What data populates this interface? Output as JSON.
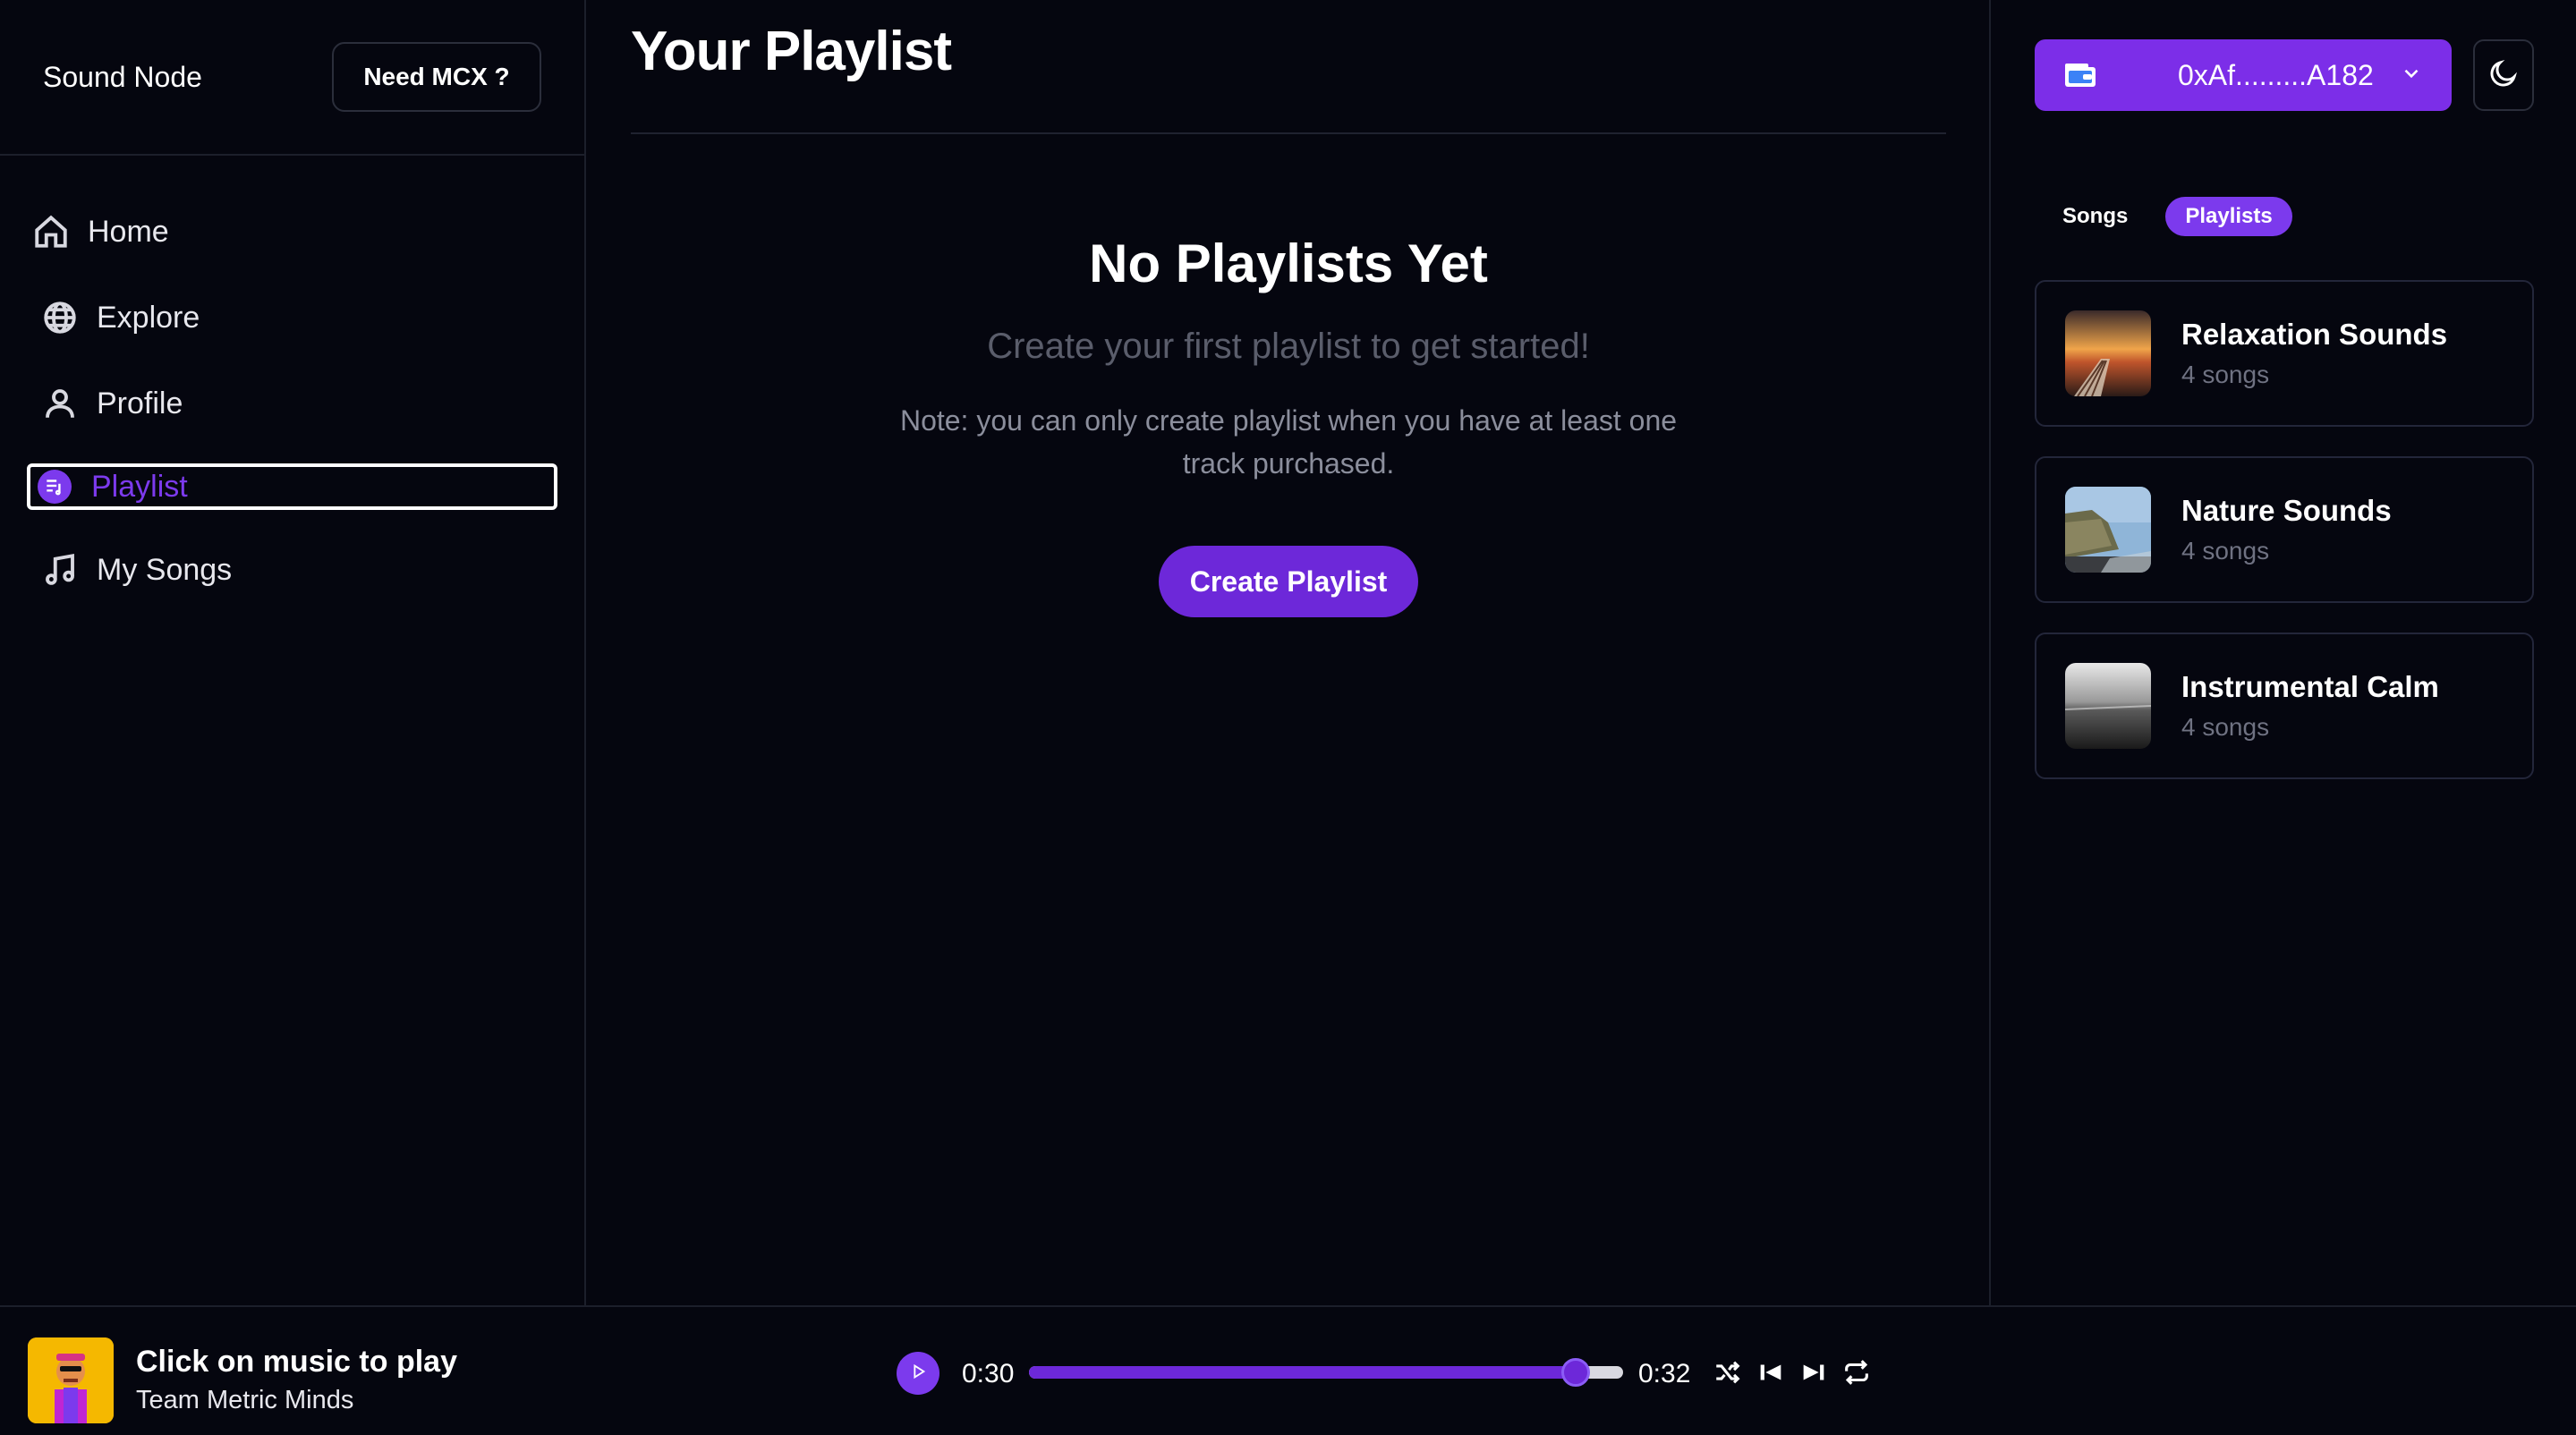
{
  "sidebar": {
    "brand": "Sound Node",
    "need_button": "Need MCX ?",
    "items": [
      {
        "label": "Home",
        "icon": "home-icon"
      },
      {
        "label": "Explore",
        "icon": "globe-icon"
      },
      {
        "label": "Profile",
        "icon": "user-icon"
      },
      {
        "label": "Playlist",
        "icon": "playlist-icon",
        "active": true
      },
      {
        "label": "My Songs",
        "icon": "music-note-icon"
      }
    ]
  },
  "main": {
    "title": "Your Playlist",
    "empty_heading": "No Playlists Yet",
    "empty_sub": "Create your first playlist to get started!",
    "empty_note": "Note: you can only create playlist when you have at least one track purchased.",
    "create_button": "Create Playlist"
  },
  "right": {
    "wallet_address": "0xAf.........A182",
    "tabs": [
      {
        "label": "Songs",
        "selected": false
      },
      {
        "label": "Playlists",
        "selected": true
      }
    ],
    "playlists": [
      {
        "title": "Relaxation Sounds",
        "count": "4 songs"
      },
      {
        "title": "Nature Sounds",
        "count": "4 songs"
      },
      {
        "title": "Instrumental Calm",
        "count": "4 songs"
      }
    ]
  },
  "player": {
    "title": "Click on music to play",
    "artist": "Team Metric Minds",
    "current_time": "0:30",
    "end_time": "0:32",
    "progress": 0.92
  },
  "colors": {
    "background": "#05060f",
    "accent": "#7c3aed",
    "wallet": "#7c2ee8",
    "muted_text": "#6f7282"
  }
}
